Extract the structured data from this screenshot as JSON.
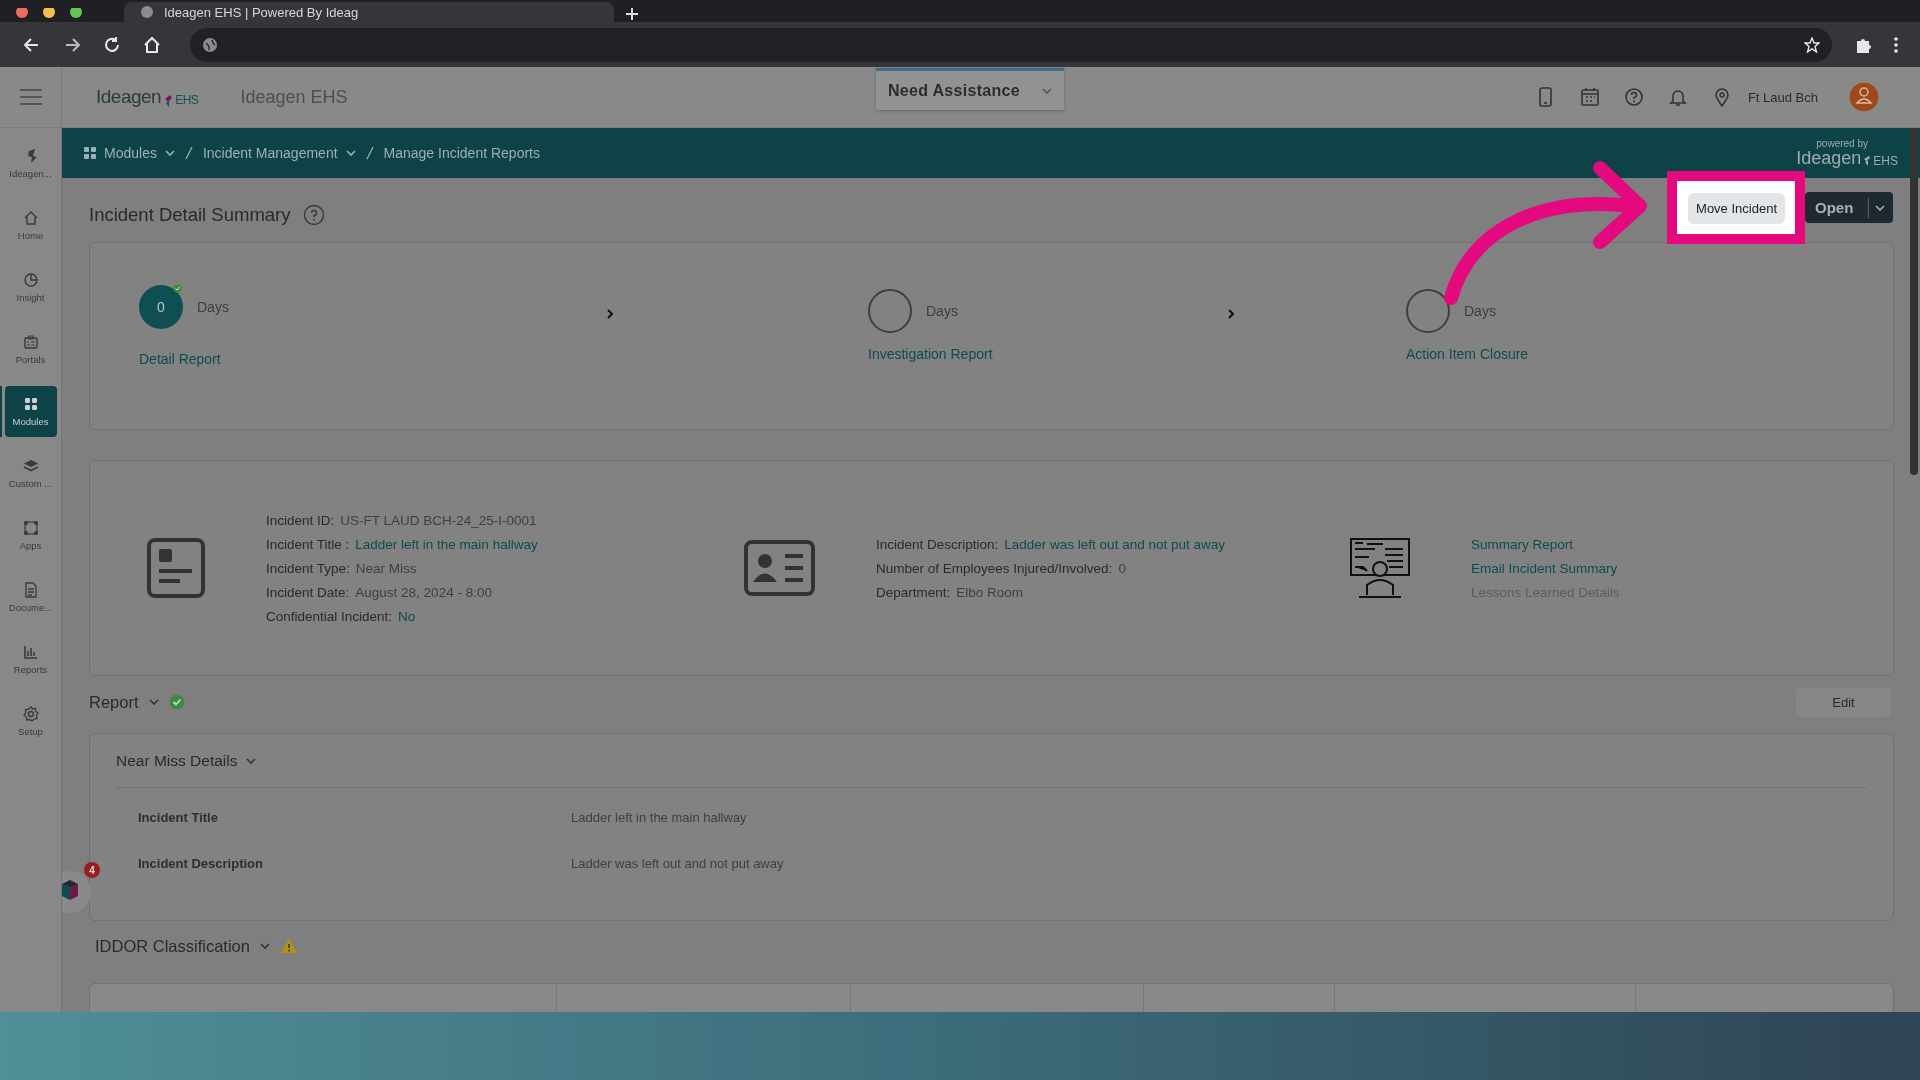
{
  "browser": {
    "tab_title": "Ideagen EHS | Powered By Ideag"
  },
  "header": {
    "logo": "Ideagen",
    "logo_suffix": "EHS",
    "product": "Ideagen EHS",
    "assistance": "Need Assistance",
    "location": "Ft Laud Bch"
  },
  "sidebar": [
    {
      "label": "Ideagen...",
      "selected": false
    },
    {
      "label": "Home",
      "selected": false
    },
    {
      "label": "Insight",
      "selected": false
    },
    {
      "label": "Portals",
      "selected": false
    },
    {
      "label": "Modules",
      "selected": true
    },
    {
      "label": "Custom ...",
      "selected": false
    },
    {
      "label": "Apps",
      "selected": false
    },
    {
      "label": "Docume...",
      "selected": false
    },
    {
      "label": "Reports",
      "selected": false
    },
    {
      "label": "Setup",
      "selected": false
    }
  ],
  "breadcrumb": [
    {
      "label": "Modules",
      "dropdown": true
    },
    {
      "label": "Incident Management",
      "dropdown": true
    },
    {
      "label": "Manage Incident Reports",
      "dropdown": false
    }
  ],
  "powered_by": {
    "caption": "powered by",
    "logo": "Ideagen",
    "suffix": "EHS"
  },
  "page_title": "Incident Detail Summary",
  "actions": [
    {
      "kind": "button",
      "label": "Move Incident",
      "highlighted": true
    },
    {
      "kind": "split",
      "label": "Open",
      "highlighted": false
    }
  ],
  "steps": [
    {
      "count": "0",
      "unit": "Days",
      "label": "Detail Report",
      "done": true
    },
    {
      "unit": "Days",
      "label": "Investigation Report",
      "done": false
    },
    {
      "unit": "Days",
      "label": "Action Item Closure",
      "done": false
    }
  ],
  "details": {
    "left": [
      {
        "label": "Incident ID:",
        "value": "US-FT LAUD BCH-24_25-I-0001",
        "link": false
      },
      {
        "label": "Incident Title :",
        "value": "Ladder left in the main hallway",
        "link": true
      },
      {
        "label": "Incident Type:",
        "value": "Near Miss",
        "link": false
      },
      {
        "label": "Incident Date:",
        "value": "August 28, 2024 - 8:00",
        "link": false
      },
      {
        "label": "Confidential Incident:",
        "value": "No",
        "link": true
      }
    ],
    "right": [
      {
        "label": "Incident Description:",
        "value": "Ladder was left out and not put away",
        "link": true
      },
      {
        "label": "Number of Employees Injured/Involved:",
        "value": "0",
        "link": false
      },
      {
        "label": "Department:",
        "value": "Elbo Room",
        "link": false
      }
    ],
    "links": [
      {
        "label": "Summary Report",
        "disabled": false
      },
      {
        "label": "Email Incident Summary",
        "disabled": false
      },
      {
        "label": "Lessons Learned Details",
        "disabled": true
      }
    ]
  },
  "report": {
    "title": "Report",
    "complete": true,
    "edit": "Edit"
  },
  "near_miss": {
    "title": "Near Miss Details",
    "rows": [
      {
        "label": "Incident Title",
        "value": "Ladder left in the main hallway"
      },
      {
        "label": "Incident Description",
        "value": "Ladder was left out and not put away"
      }
    ]
  },
  "riddor": {
    "title": "IDDOR Classification",
    "warning": true
  },
  "widget": {
    "badge": "4"
  }
}
